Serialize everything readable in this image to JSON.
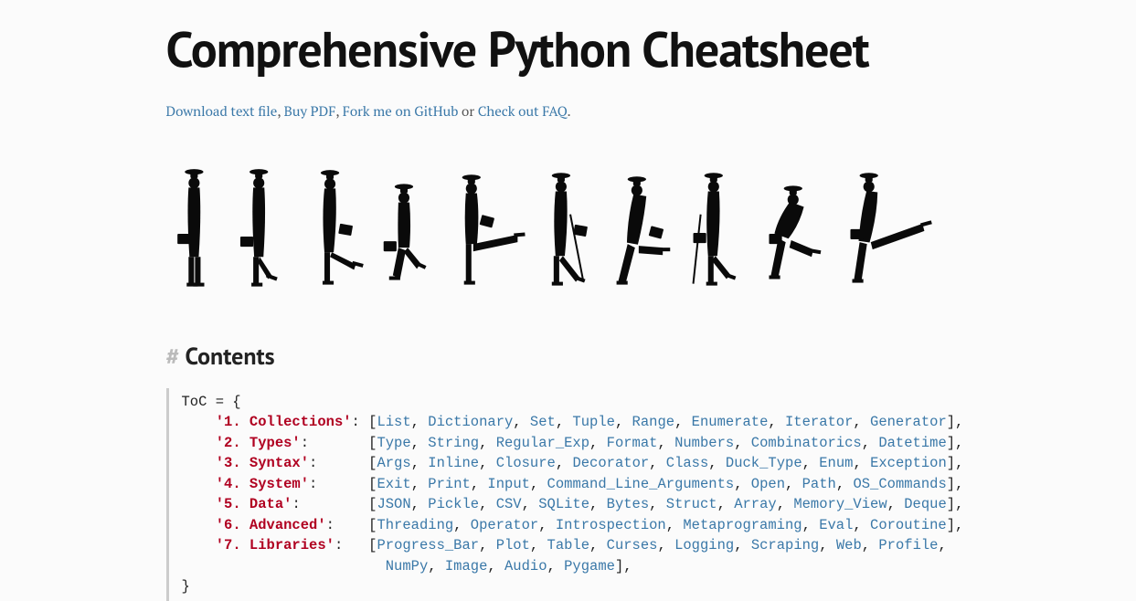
{
  "title": "Comprehensive Python Cheatsheet",
  "links": {
    "download": "Download text file",
    "buy": "Buy PDF",
    "fork": "Fork me on GitHub",
    "or": " or ",
    "faq": "Check out FAQ",
    "period": "."
  },
  "contents": {
    "hash": "#",
    "label": "Contents"
  },
  "toc": {
    "open": "ToC = {",
    "close": "}",
    "rows": [
      {
        "key": "'1. Collections'",
        "items": [
          "List",
          "Dictionary",
          "Set",
          "Tuple",
          "Range",
          "Enumerate",
          "Iterator",
          "Generator"
        ]
      },
      {
        "key": "'2. Types'",
        "items": [
          "Type",
          "String",
          "Regular_Exp",
          "Format",
          "Numbers",
          "Combinatorics",
          "Datetime"
        ]
      },
      {
        "key": "'3. Syntax'",
        "items": [
          "Args",
          "Inline",
          "Closure",
          "Decorator",
          "Class",
          "Duck_Type",
          "Enum",
          "Exception"
        ]
      },
      {
        "key": "'4. System'",
        "items": [
          "Exit",
          "Print",
          "Input",
          "Command_Line_Arguments",
          "Open",
          "Path",
          "OS_Commands"
        ]
      },
      {
        "key": "'5. Data'",
        "items": [
          "JSON",
          "Pickle",
          "CSV",
          "SQLite",
          "Bytes",
          "Struct",
          "Array",
          "Memory_View",
          "Deque"
        ]
      },
      {
        "key": "'6. Advanced'",
        "items": [
          "Threading",
          "Operator",
          "Introspection",
          "Metaprograming",
          "Eval",
          "Coroutine"
        ]
      },
      {
        "key": "'7. Libraries'",
        "items": [
          "Progress_Bar",
          "Plot",
          "Table",
          "Curses",
          "Logging",
          "Scraping",
          "Web",
          "Profile",
          "NumPy",
          "Image",
          "Audio",
          "Pygame"
        ]
      }
    ]
  }
}
